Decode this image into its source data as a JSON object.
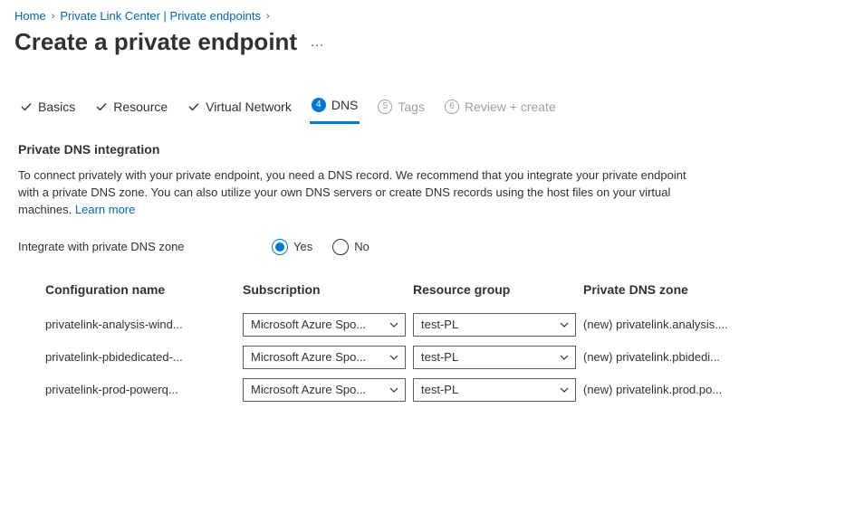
{
  "breadcrumb": {
    "home": "Home",
    "center": "Private Link Center | Private endpoints"
  },
  "page_title": "Create a private endpoint",
  "tabs": {
    "basics": "Basics",
    "resource": "Resource",
    "vnet": "Virtual Network",
    "dns": "DNS",
    "dns_num": "4",
    "tags": "Tags",
    "tags_num": "5",
    "review": "Review + create",
    "review_num": "6"
  },
  "dns_section": {
    "title": "Private DNS integration",
    "description": "To connect privately with your private endpoint, you need a DNS record. We recommend that you integrate your private endpoint with a private DNS zone. You can also utilize your own DNS servers or create DNS records using the host files on your virtual machines.  ",
    "learn_more": "Learn more",
    "integrate_label": "Integrate with private DNS zone",
    "yes": "Yes",
    "no": "No"
  },
  "table": {
    "headers": {
      "config": "Configuration name",
      "sub": "Subscription",
      "rg": "Resource group",
      "zone": "Private DNS zone"
    },
    "rows": [
      {
        "config": "privatelink-analysis-wind...",
        "sub": "Microsoft Azure Spo...",
        "rg": "test-PL",
        "zone": "(new) privatelink.analysis...."
      },
      {
        "config": "privatelink-pbidedicated-...",
        "sub": "Microsoft Azure Spo...",
        "rg": "test-PL",
        "zone": "(new) privatelink.pbidedi..."
      },
      {
        "config": "privatelink-prod-powerq...",
        "sub": "Microsoft Azure Spo...",
        "rg": "test-PL",
        "zone": "(new) privatelink.prod.po..."
      }
    ]
  }
}
